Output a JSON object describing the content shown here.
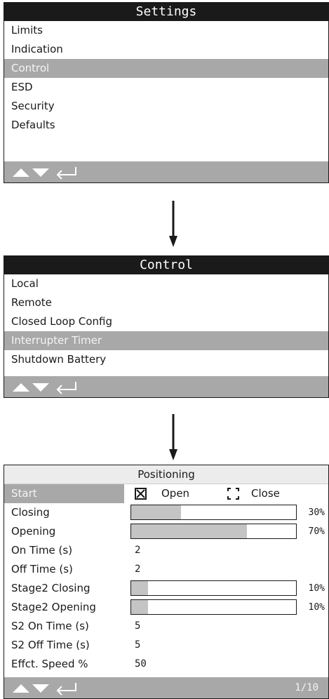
{
  "settings_screen": {
    "title": "Settings",
    "items": [
      "Limits",
      "Indication",
      "Control",
      "ESD",
      "Security",
      "Defaults"
    ],
    "selected": "Control"
  },
  "control_screen": {
    "title": "Control",
    "items": [
      "Local",
      "Remote",
      "Closed Loop Config",
      "Interrupter Timer",
      "Shutdown Battery"
    ],
    "selected": "Interrupter Timer"
  },
  "positioning_screen": {
    "title": "Positioning",
    "start": {
      "label": "Start",
      "option_open": "Open",
      "option_close": "Close",
      "open_checked": true,
      "close_checked": false
    },
    "closing": {
      "label": "Closing",
      "percent": 30,
      "text": "30%"
    },
    "opening": {
      "label": "Opening",
      "percent": 70,
      "text": "70%"
    },
    "on_time": {
      "label": "On Time (s)",
      "value": "2"
    },
    "off_time": {
      "label": "Off Time (s)",
      "value": "2"
    },
    "stage2_closing": {
      "label": "Stage2 Closing",
      "percent": 10,
      "text": "10%"
    },
    "stage2_opening": {
      "label": "Stage2 Opening",
      "percent": 10,
      "text": "10%"
    },
    "s2_on_time": {
      "label": "S2 On Time (s)",
      "value": "5"
    },
    "s2_off_time": {
      "label": "S2 Off Time (s)",
      "value": "5"
    },
    "effct_speed": {
      "label": "Effct. Speed %",
      "value": "50"
    },
    "page_indicator": "1/10"
  },
  "footer_icons": [
    "up-triangle-icon",
    "down-triangle-icon",
    "enter-return-icon"
  ],
  "colors": {
    "title_bar": "#1a1a1a",
    "selected_row": "#a8a8a8",
    "footer": "#a8a8a8",
    "bar_fill": "#c4c4c4"
  }
}
